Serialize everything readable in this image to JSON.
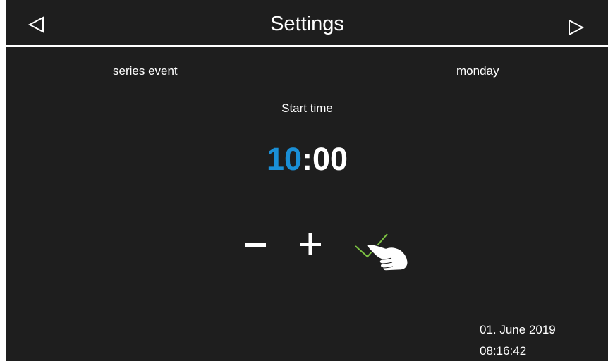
{
  "header": {
    "title": "Settings",
    "prev_icon": "triangle-left-icon",
    "next_icon": "triangle-right-icon"
  },
  "main": {
    "mode_label": "series event",
    "day_label": "monday",
    "field_label": "Start time",
    "time": {
      "hours": "10",
      "separator": ":",
      "minutes": "00"
    },
    "controls": {
      "decrement_icon": "minus-icon",
      "increment_icon": "plus-icon",
      "confirm_icon": "checkmark-icon"
    }
  },
  "status": {
    "date": "01. June 2019",
    "time": "08:16:42"
  },
  "colors": {
    "background": "#1e1e1e",
    "text": "#ffffff",
    "accent": "#1a8fd6",
    "confirm": "#7cc242"
  }
}
